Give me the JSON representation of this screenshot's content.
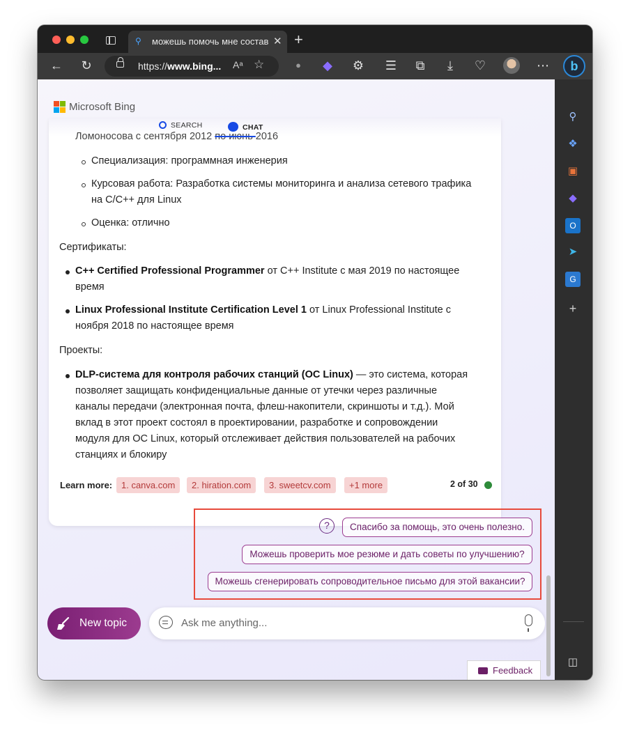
{
  "browser": {
    "tab_title": "можешь помочь мне состави",
    "url_prefix": "https://",
    "url_host": "www.bing...",
    "read_aloud": "Aͅ",
    "new_tab": "+",
    "tab_close": "✕"
  },
  "header": {
    "brand": "Microsoft Bing",
    "nav_search": "SEARCH",
    "nav_chat": "CHAT"
  },
  "message": {
    "top_line_start": "Ломоносова с сентября 2012 ",
    "top_line_strike": "по июнь ",
    "top_line_end": "2016",
    "edu_bullets": [
      "Специализация: программная инженерия",
      "Курсовая работа: Разработка системы мониторинга и анализа сетевого трафика",
      "на C/C++ для Linux",
      "Оценка: отлично"
    ],
    "certs_heading": "Сертификаты:",
    "cert1_bold": "C++ Certified Professional Programmer",
    "cert1_rest": " от C++ Institute с мая 2019 по настоящее",
    "cert1_line2": "время",
    "cert2_bold": "Linux Professional Institute Certification Level 1",
    "cert2_rest": " от Linux Professional Institute с",
    "cert2_line2": "ноября 2018 по настоящее время",
    "projects_heading": "Проекты:",
    "proj_bold": "DLP-система для контроля рабочих станций (ОС Linux)",
    "proj_rest": " — это система, которая",
    "proj_lines": [
      "позволяет защищать конфиденциальные данные от утечки через различные",
      "каналы передачи (электронная почта, флеш-накопители, скриншоты и т.д.). Мой",
      "вклад в этот проект состоял в проектировании, разработке и сопровождении",
      "модуля для ОС Linux, который отслеживает действия пользователей на рабочих",
      "станциях и блокиру"
    ]
  },
  "learn_more": {
    "label": "Learn more:",
    "chips": [
      "1. canva.com",
      "2. hiration.com",
      "3. sweetcv.com",
      "+1 more"
    ],
    "counter": "2 of 30",
    "status_color": "#2e8b3a"
  },
  "suggestions": [
    "Спасибо за помощь, это очень полезно.",
    "Можешь проверить мое резюме и дать советы по улучшению?",
    "Можешь сгенерировать сопроводительное письмо для этой вакансии?"
  ],
  "input": {
    "new_topic": "New topic",
    "placeholder": "Ask me anything..."
  },
  "feedback": "Feedback",
  "icons": {
    "toolbar": [
      "back-icon",
      "refresh-icon",
      "lock-icon",
      "read-aloud-icon",
      "favorite-icon",
      "extension-icon",
      "copilot-icon",
      "puzzle-icon",
      "favorites-icon",
      "collections-icon",
      "download-icon",
      "health-icon",
      "profile-avatar",
      "more-icon",
      "bing-chat-icon"
    ],
    "sidebar": [
      "search-icon",
      "tag-icon",
      "briefcase-icon",
      "copilot-icon",
      "outlook-icon",
      "send-icon",
      "translator-icon",
      "add-icon",
      "sidebar-toggle-icon",
      "settings-icon"
    ]
  },
  "colors": {
    "accent": "#7a1f73",
    "highlight_box": "#e74a3b",
    "chip_bg": "#f7d4d4",
    "chip_text": "#b33a3a",
    "bing_blue": "#174ae4"
  }
}
